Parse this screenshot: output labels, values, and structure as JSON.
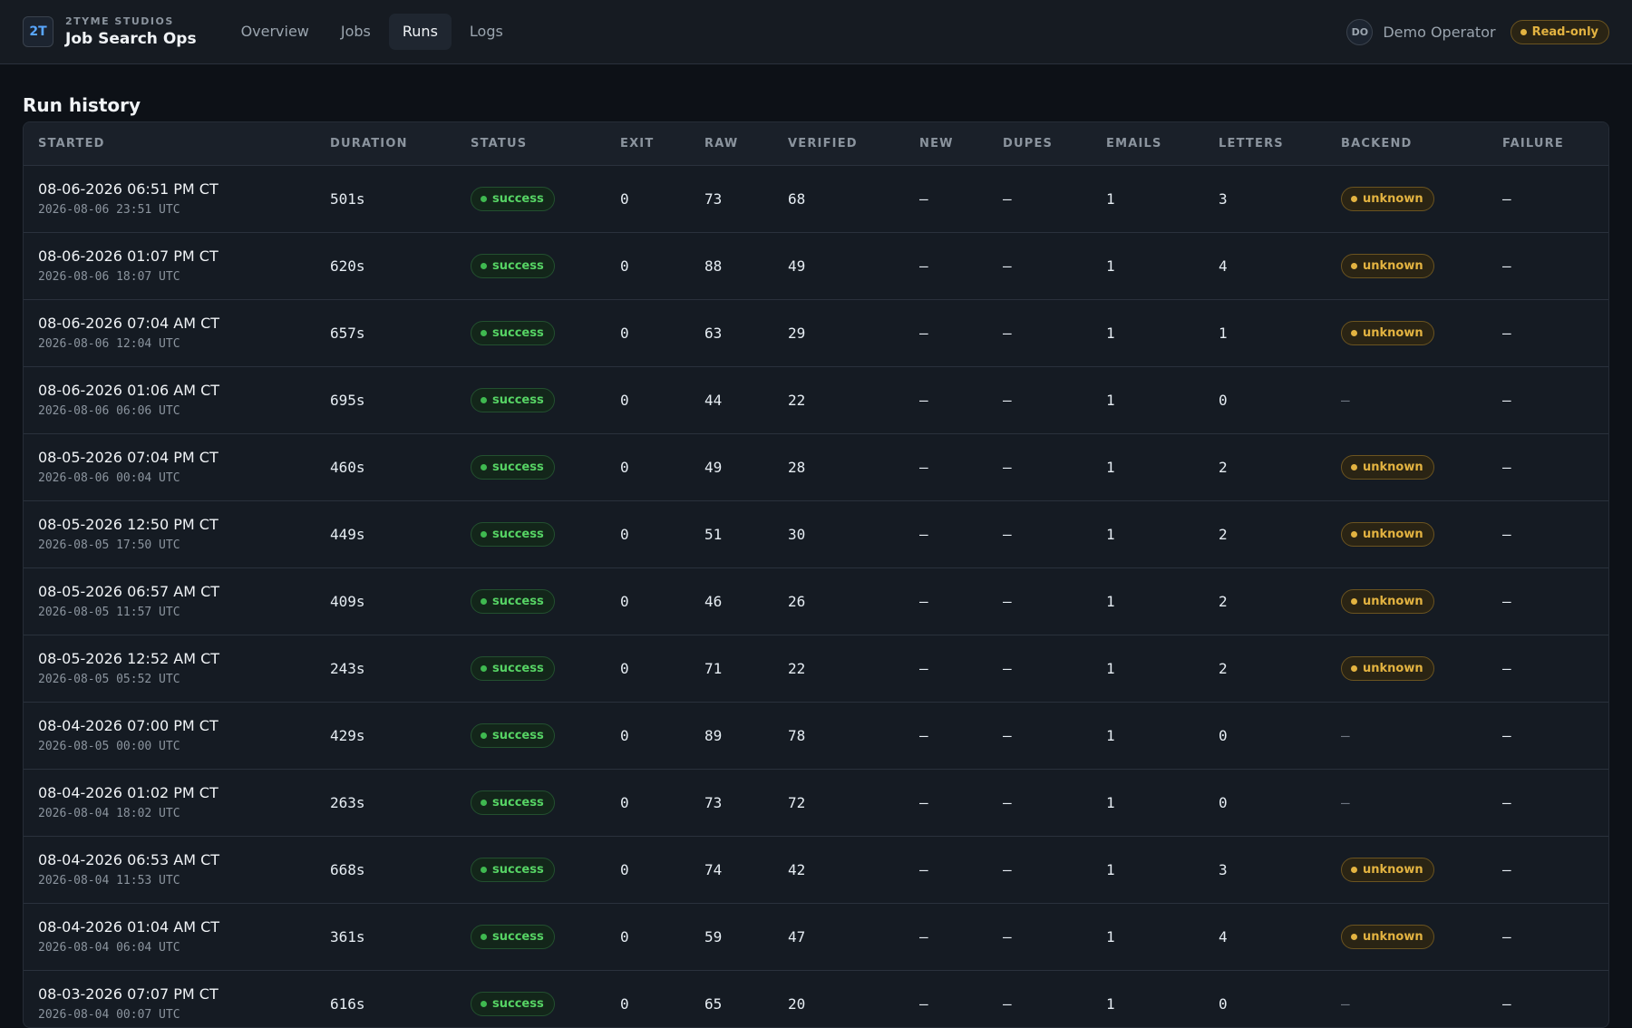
{
  "brand": {
    "logo": "2T",
    "org": "2TYME STUDIOS",
    "app": "Job Search Ops"
  },
  "nav": [
    {
      "label": "Overview",
      "active": false
    },
    {
      "label": "Jobs",
      "active": false
    },
    {
      "label": "Runs",
      "active": true
    },
    {
      "label": "Logs",
      "active": false
    }
  ],
  "user": {
    "initials": "DO",
    "name": "Demo Operator",
    "badge": "Read-only"
  },
  "section_title": "Run history",
  "columns": [
    "STARTED",
    "DURATION",
    "STATUS",
    "EXIT",
    "RAW",
    "VERIFIED",
    "NEW",
    "DUPES",
    "EMAILS",
    "LETTERS",
    "BACKEND",
    "FAILURE"
  ],
  "rows": [
    {
      "ct": "08-06-2026 06:51 PM CT",
      "utc": "2026-08-06 23:51 UTC",
      "duration": "501s",
      "status": "success",
      "exit": "0",
      "raw": "73",
      "verified": "68",
      "new": "—",
      "dupes": "—",
      "emails": "1",
      "letters": "3",
      "backend": "unknown",
      "failure": "—"
    },
    {
      "ct": "08-06-2026 01:07 PM CT",
      "utc": "2026-08-06 18:07 UTC",
      "duration": "620s",
      "status": "success",
      "exit": "0",
      "raw": "88",
      "verified": "49",
      "new": "—",
      "dupes": "—",
      "emails": "1",
      "letters": "4",
      "backend": "unknown",
      "failure": "—"
    },
    {
      "ct": "08-06-2026 07:04 AM CT",
      "utc": "2026-08-06 12:04 UTC",
      "duration": "657s",
      "status": "success",
      "exit": "0",
      "raw": "63",
      "verified": "29",
      "new": "—",
      "dupes": "—",
      "emails": "1",
      "letters": "1",
      "backend": "unknown",
      "failure": "—"
    },
    {
      "ct": "08-06-2026 01:06 AM CT",
      "utc": "2026-08-06 06:06 UTC",
      "duration": "695s",
      "status": "success",
      "exit": "0",
      "raw": "44",
      "verified": "22",
      "new": "—",
      "dupes": "—",
      "emails": "1",
      "letters": "0",
      "backend": "—",
      "failure": "—"
    },
    {
      "ct": "08-05-2026 07:04 PM CT",
      "utc": "2026-08-06 00:04 UTC",
      "duration": "460s",
      "status": "success",
      "exit": "0",
      "raw": "49",
      "verified": "28",
      "new": "—",
      "dupes": "—",
      "emails": "1",
      "letters": "2",
      "backend": "unknown",
      "failure": "—"
    },
    {
      "ct": "08-05-2026 12:50 PM CT",
      "utc": "2026-08-05 17:50 UTC",
      "duration": "449s",
      "status": "success",
      "exit": "0",
      "raw": "51",
      "verified": "30",
      "new": "—",
      "dupes": "—",
      "emails": "1",
      "letters": "2",
      "backend": "unknown",
      "failure": "—"
    },
    {
      "ct": "08-05-2026 06:57 AM CT",
      "utc": "2026-08-05 11:57 UTC",
      "duration": "409s",
      "status": "success",
      "exit": "0",
      "raw": "46",
      "verified": "26",
      "new": "—",
      "dupes": "—",
      "emails": "1",
      "letters": "2",
      "backend": "unknown",
      "failure": "—"
    },
    {
      "ct": "08-05-2026 12:52 AM CT",
      "utc": "2026-08-05 05:52 UTC",
      "duration": "243s",
      "status": "success",
      "exit": "0",
      "raw": "71",
      "verified": "22",
      "new": "—",
      "dupes": "—",
      "emails": "1",
      "letters": "2",
      "backend": "unknown",
      "failure": "—"
    },
    {
      "ct": "08-04-2026 07:00 PM CT",
      "utc": "2026-08-05 00:00 UTC",
      "duration": "429s",
      "status": "success",
      "exit": "0",
      "raw": "89",
      "verified": "78",
      "new": "—",
      "dupes": "—",
      "emails": "1",
      "letters": "0",
      "backend": "—",
      "failure": "—"
    },
    {
      "ct": "08-04-2026 01:02 PM CT",
      "utc": "2026-08-04 18:02 UTC",
      "duration": "263s",
      "status": "success",
      "exit": "0",
      "raw": "73",
      "verified": "72",
      "new": "—",
      "dupes": "—",
      "emails": "1",
      "letters": "0",
      "backend": "—",
      "failure": "—"
    },
    {
      "ct": "08-04-2026 06:53 AM CT",
      "utc": "2026-08-04 11:53 UTC",
      "duration": "668s",
      "status": "success",
      "exit": "0",
      "raw": "74",
      "verified": "42",
      "new": "—",
      "dupes": "—",
      "emails": "1",
      "letters": "3",
      "backend": "unknown",
      "failure": "—"
    },
    {
      "ct": "08-04-2026 01:04 AM CT",
      "utc": "2026-08-04 06:04 UTC",
      "duration": "361s",
      "status": "success",
      "exit": "0",
      "raw": "59",
      "verified": "47",
      "new": "—",
      "dupes": "—",
      "emails": "1",
      "letters": "4",
      "backend": "unknown",
      "failure": "—"
    },
    {
      "ct": "08-03-2026 07:07 PM CT",
      "utc": "2026-08-04 00:07 UTC",
      "duration": "616s",
      "status": "success",
      "exit": "0",
      "raw": "65",
      "verified": "20",
      "new": "—",
      "dupes": "—",
      "emails": "1",
      "letters": "0",
      "backend": "—",
      "failure": "—"
    }
  ]
}
